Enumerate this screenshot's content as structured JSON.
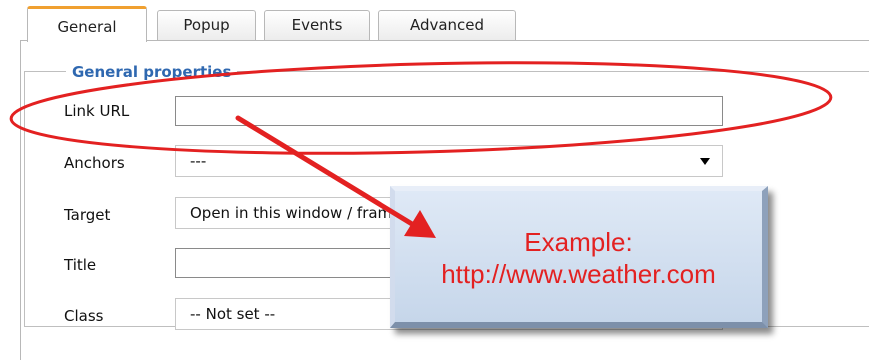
{
  "tabs": [
    {
      "label": "General",
      "active": true
    },
    {
      "label": "Popup",
      "active": false
    },
    {
      "label": "Events",
      "active": false
    },
    {
      "label": "Advanced",
      "active": false
    }
  ],
  "fieldset": {
    "legend": "General properties"
  },
  "fields": {
    "link_url": {
      "label": "Link URL",
      "value": ""
    },
    "anchors": {
      "label": "Anchors",
      "value": "---"
    },
    "target": {
      "label": "Target",
      "value": "Open in this window / frame"
    },
    "title": {
      "label": "Title",
      "value": ""
    },
    "class": {
      "label": "Class",
      "value": "-- Not set --"
    }
  },
  "callout": {
    "line1": "Example:",
    "line2": "http://www.weather.com"
  },
  "colors": {
    "active_tab_accent": "#f0a030",
    "legend_text": "#2f68b0",
    "annotation_red": "#e32121",
    "callout_fill": "#cfdcee"
  },
  "icons": {
    "dropdown": "chevron-down-icon",
    "annotation_arrow": "arrow-icon",
    "annotation_ellipse": "highlight-ellipse"
  }
}
